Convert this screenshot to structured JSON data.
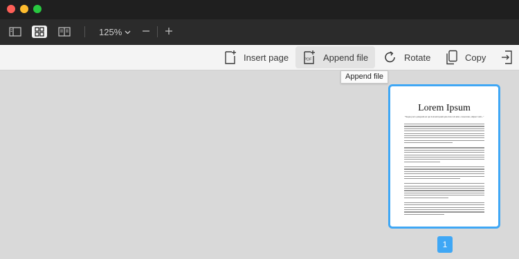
{
  "toolbar": {
    "zoom_value": "125%"
  },
  "actions": {
    "insert_page": "Insert page",
    "append_file": "Append file",
    "rotate": "Rotate",
    "copy": "Copy"
  },
  "tooltip": "Append file",
  "thumbnail": {
    "title": "Lorem Ipsum",
    "subtitle": "\"Neque porro quisquam est qui dolorem ipsum quia dolor sit amet, consectetur, adipisci velit...\"",
    "page_number": "1"
  },
  "colors": {
    "accent": "#3fa7f5",
    "titlebar": "#1f1f1f",
    "toolbar": "#2b2b2b",
    "canvas": "#d9d9d9"
  }
}
